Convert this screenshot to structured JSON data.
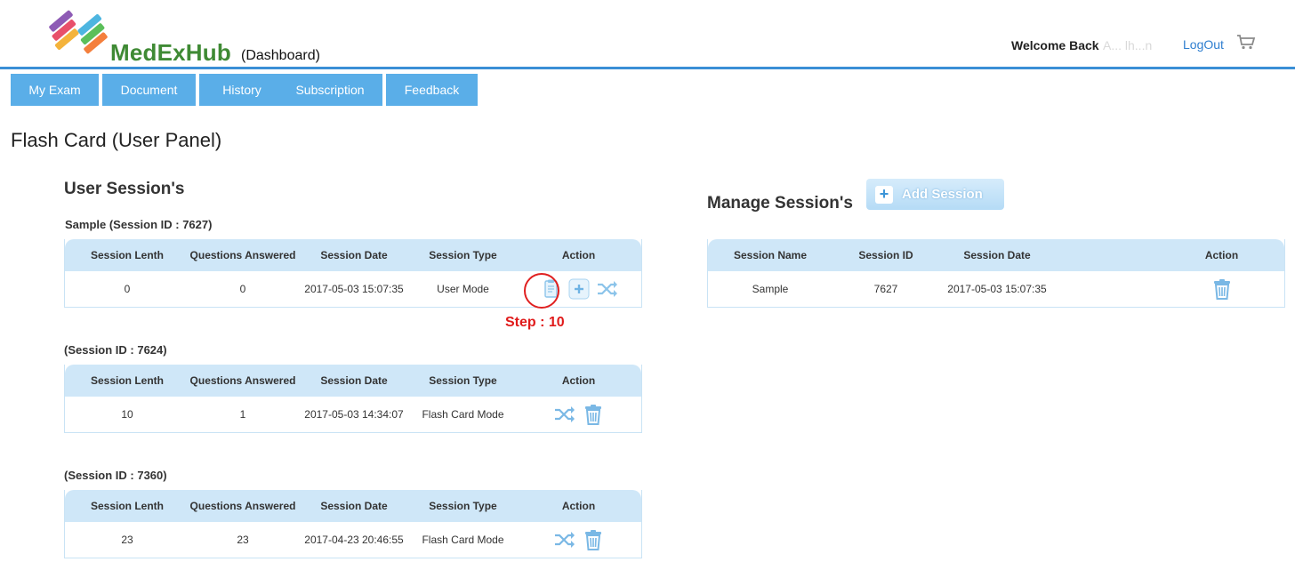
{
  "header": {
    "brand": "MedExHub",
    "brand_sub": "(Dashboard)",
    "welcome": "Welcome Back",
    "welcome_name": "A... lh...n",
    "logout": "LogOut"
  },
  "nav": {
    "tabs": [
      {
        "label": "My Exam"
      },
      {
        "label": "Document"
      },
      {
        "label": "History"
      },
      {
        "label": "Subscription"
      },
      {
        "label": "Feedback"
      }
    ]
  },
  "page_title": "Flash Card (User Panel)",
  "user_sessions": {
    "title": "User Session's",
    "headers": [
      "Session Lenth",
      "Questions Answered",
      "Session Date",
      "Session Type",
      "Action"
    ],
    "sessions": [
      {
        "label": "Sample (Session ID : 7627)",
        "length": "0",
        "answered": "0",
        "date": "2017-05-03 15:07:35",
        "type": "User Mode",
        "actions": [
          "clipboard-icon",
          "add-icon",
          "shuffle-icon"
        ]
      },
      {
        "label": "(Session ID : 7624)",
        "length": "10",
        "answered": "1",
        "date": "2017-05-03 14:34:07",
        "type": "Flash Card Mode",
        "actions": [
          "shuffle-icon",
          "trash-icon"
        ]
      },
      {
        "label": "(Session ID : 7360)",
        "length": "23",
        "answered": "23",
        "date": "2017-04-23 20:46:55",
        "type": "Flash Card Mode",
        "actions": [
          "shuffle-icon",
          "trash-icon"
        ]
      }
    ]
  },
  "annotation": {
    "step_label": "Step : 10"
  },
  "manage_sessions": {
    "title": "Manage Session's",
    "add_label": "Add Session",
    "add_plus": "+",
    "headers": [
      "Session Name",
      "Session ID",
      "Session Date",
      "Action"
    ],
    "rows": [
      {
        "name": "Sample",
        "id": "7627",
        "date": "2017-05-03 15:07:35",
        "actions": [
          "trash-icon"
        ]
      }
    ]
  },
  "colors": {
    "accent": "#5aaee8",
    "header_line": "#3a8fd6",
    "table_head": "#cfe7f8",
    "brand": "#3f8a34",
    "annotation": "#e01a1a",
    "link": "#2f7fd0"
  }
}
